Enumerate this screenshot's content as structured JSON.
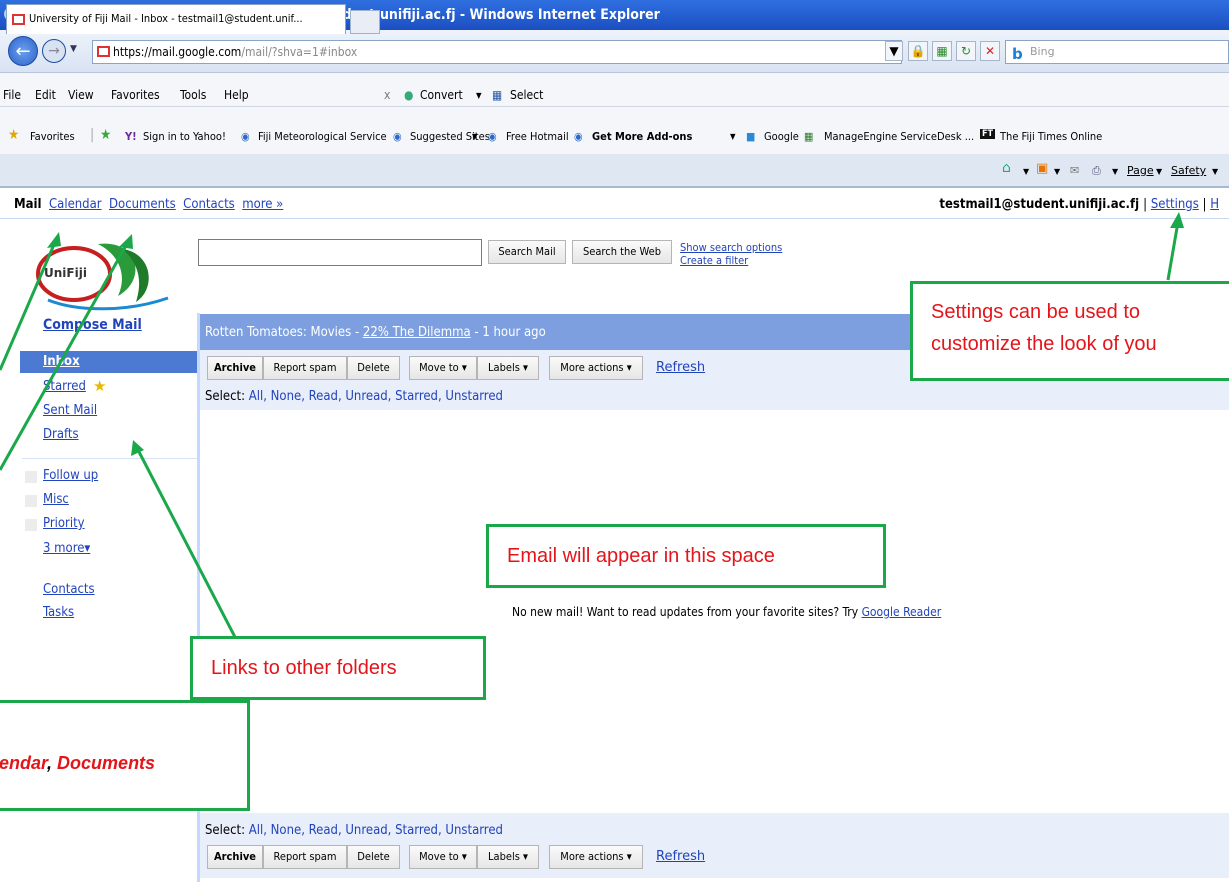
{
  "browser": {
    "title": "University of Fiji Mail - Inbox - testmail1@student.unifiji.ac.fj - Windows Internet Explorer",
    "url_host": "https://mail.google.com",
    "url_path": "/mail/?shva=1#inbox",
    "search_placeholder": "Bing",
    "menu": [
      "File",
      "Edit",
      "View",
      "Favorites",
      "Tools",
      "Help"
    ],
    "toolbar_extra": {
      "close": "x",
      "convert": "Convert",
      "select": "Select"
    },
    "favorites": {
      "label": "Favorites",
      "items": [
        "Sign in to Yahoo!",
        "Fiji Meteorological Service",
        "Suggested Sites",
        "Free Hotmail",
        "Get More Add-ons",
        "Google",
        "ManageEngine ServiceDesk ...",
        "The Fiji Times Online"
      ]
    },
    "tab_title": "University of Fiji Mail - Inbox - testmail1@student.unif...",
    "command_bar": {
      "page": "Page",
      "safety": "Safety"
    }
  },
  "gmail": {
    "topnav": {
      "mail": "Mail",
      "calendar": "Calendar",
      "documents": "Documents",
      "contacts": "Contacts",
      "more": "more »"
    },
    "account": {
      "email": "testmail1@student.unifiji.ac.fj",
      "settings": "Settings",
      "trailing": "H"
    },
    "logo_text": "UniFiji",
    "search": {
      "mail_button": "Search Mail",
      "web_button": "Search the Web",
      "options": "Show search options",
      "filter": "Create a filter"
    },
    "sidebar": {
      "compose": "Compose Mail",
      "folders": [
        "Inbox",
        "Starred",
        "Sent Mail",
        "Drafts"
      ],
      "labels": [
        "Follow up",
        "Misc",
        "Priority"
      ],
      "more_labels": "3 more▾",
      "contacts": "Contacts",
      "tasks": "Tasks"
    },
    "news": {
      "source": "Rotten Tomatoes: Movies - ",
      "headline": "22% The Dilemma",
      "age": " - 1 hour ago"
    },
    "actions": {
      "archive": "Archive",
      "spam": "Report spam",
      "delete": "Delete",
      "move": "Move to ▾",
      "labels": "Labels ▾",
      "more": "More actions ▾",
      "refresh": "Refresh"
    },
    "select": {
      "label": "Select: ",
      "options": "All, None, Read, Unread, Starred, Unstarred"
    },
    "empty": {
      "text": "No new mail! Want to read updates from your favorite sites? Try ",
      "link": "Google Reader"
    }
  },
  "annotations": {
    "settings_line1": "Settings can be used to",
    "settings_line2": "customize the look of you",
    "email_space": "Email will appear in this space",
    "folders": "Links to other folders",
    "calendar_docs_a": "endar",
    "calendar_docs_sep": ", ",
    "calendar_docs_b": "Documents"
  },
  "colors": {
    "annotation_border": "#1aa84a",
    "annotation_text": "#e3151a",
    "link": "#2244bb",
    "gmail_blue": "#c3d9ff"
  }
}
